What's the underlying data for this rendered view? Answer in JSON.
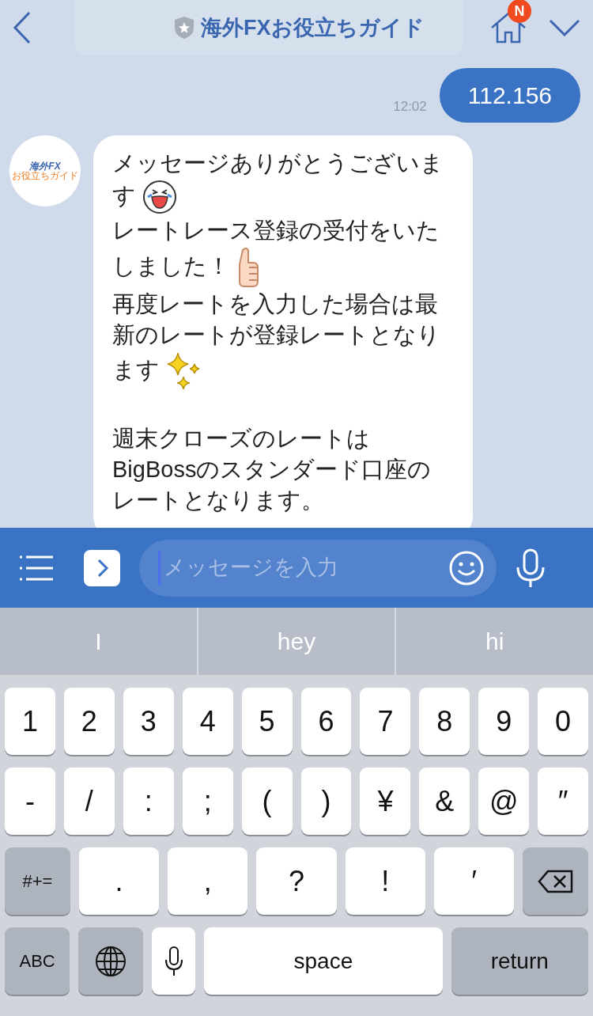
{
  "header": {
    "title": "海外FXお役立ちガイド",
    "badge": "N"
  },
  "sent": {
    "text": "112.156",
    "time": "12:02"
  },
  "avatar": {
    "logo_top": "海外FX",
    "logo_bottom": "お役立ちガイド"
  },
  "received": [
    {
      "lines": [
        {
          "text": "メッセージありがとうございま"
        },
        {
          "text": "す",
          "kind": "laugh"
        },
        {
          "text": "レートレース登録の受付をいた"
        },
        {
          "text": "しました！",
          "kind": "thumbs"
        },
        {
          "text": "再度レートを入力した場合は最"
        },
        {
          "text": "新のレートが登録レートとなり"
        },
        {
          "text": "ます",
          "kind": "sparkle"
        }
      ]
    },
    {
      "lines": [
        {
          "text": "週末クローズのレートは"
        },
        {
          "text": "BigBossのスタンダード口座の"
        },
        {
          "text": "レートとなります。"
        }
      ]
    }
  ],
  "input": {
    "placeholder": "メッセージを入力"
  },
  "suggestions": [
    "I",
    "hey",
    "hi"
  ],
  "keyboard": [
    [
      {
        "kind": "char",
        "label": "1"
      },
      {
        "kind": "char",
        "label": "2"
      },
      {
        "kind": "char",
        "label": "3"
      },
      {
        "kind": "char",
        "label": "4"
      },
      {
        "kind": "char",
        "label": "5"
      },
      {
        "kind": "char",
        "label": "6"
      },
      {
        "kind": "char",
        "label": "7"
      },
      {
        "kind": "char",
        "label": "8"
      },
      {
        "kind": "char",
        "label": "9"
      },
      {
        "kind": "char",
        "label": "0"
      }
    ],
    [
      {
        "kind": "char",
        "label": "-"
      },
      {
        "kind": "char",
        "label": "/"
      },
      {
        "kind": "char",
        "label": ":"
      },
      {
        "kind": "char",
        "label": ";"
      },
      {
        "kind": "char",
        "label": "("
      },
      {
        "kind": "char",
        "label": ")"
      },
      {
        "kind": "char",
        "label": "¥"
      },
      {
        "kind": "char",
        "label": "&"
      },
      {
        "kind": "char",
        "label": "@"
      },
      {
        "kind": "char",
        "label": "″"
      }
    ],
    [
      {
        "kind": "function",
        "label": "#+="
      },
      {
        "kind": "wide",
        "label": "."
      },
      {
        "kind": "wide",
        "label": ","
      },
      {
        "kind": "wide",
        "label": "?"
      },
      {
        "kind": "wide",
        "label": "!"
      },
      {
        "kind": "wide",
        "label": "′"
      },
      {
        "kind": "backspace"
      }
    ],
    [
      {
        "kind": "function",
        "label": "ABC"
      },
      {
        "kind": "globe"
      },
      {
        "kind": "mic"
      },
      {
        "kind": "space",
        "label": "space"
      },
      {
        "kind": "return",
        "label": "return"
      }
    ]
  ]
}
